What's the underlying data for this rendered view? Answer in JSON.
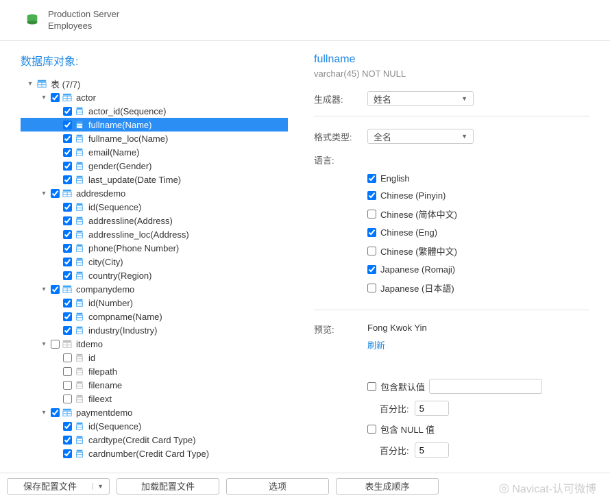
{
  "header": {
    "server": "Production Server",
    "database": "Employees"
  },
  "left": {
    "title": "数据库对象:",
    "root_label": "表 (7/7)",
    "tables": [
      {
        "name": "actor",
        "checked": true,
        "expanded": true,
        "active": true,
        "columns": [
          {
            "label": "actor_id(Sequence)",
            "checked": true
          },
          {
            "label": "fullname(Name)",
            "checked": true,
            "selected": true
          },
          {
            "label": "fullname_loc(Name)",
            "checked": true
          },
          {
            "label": "email(Name)",
            "checked": true
          },
          {
            "label": "gender(Gender)",
            "checked": true
          },
          {
            "label": "last_update(Date Time)",
            "checked": true
          }
        ]
      },
      {
        "name": "addresdemo",
        "checked": true,
        "expanded": true,
        "active": true,
        "columns": [
          {
            "label": "id(Sequence)",
            "checked": true
          },
          {
            "label": "addressline(Address)",
            "checked": true
          },
          {
            "label": "addressline_loc(Address)",
            "checked": true
          },
          {
            "label": "phone(Phone Number)",
            "checked": true
          },
          {
            "label": "city(City)",
            "checked": true
          },
          {
            "label": "country(Region)",
            "checked": true
          }
        ]
      },
      {
        "name": "companydemo",
        "checked": true,
        "expanded": true,
        "active": true,
        "columns": [
          {
            "label": "id(Number)",
            "checked": true
          },
          {
            "label": "compname(Name)",
            "checked": true
          },
          {
            "label": "industry(Industry)",
            "checked": true
          }
        ]
      },
      {
        "name": "itdemo",
        "checked": false,
        "expanded": true,
        "active": false,
        "columns": [
          {
            "label": "id",
            "checked": false
          },
          {
            "label": "filepath",
            "checked": false
          },
          {
            "label": "filename",
            "checked": false
          },
          {
            "label": "fileext",
            "checked": false
          }
        ]
      },
      {
        "name": "paymentdemo",
        "checked": true,
        "expanded": true,
        "active": true,
        "columns": [
          {
            "label": "id(Sequence)",
            "checked": true
          },
          {
            "label": "cardtype(Credit Card Type)",
            "checked": true
          },
          {
            "label": "cardnumber(Credit Card Type)",
            "checked": true
          }
        ]
      }
    ]
  },
  "right": {
    "column_name": "fullname",
    "column_type": "varchar(45) NOT NULL",
    "generator_label": "生成器:",
    "generator_value": "姓名",
    "format_label": "格式类型:",
    "format_value": "全名",
    "language_label": "语言:",
    "languages": [
      {
        "label": "English",
        "checked": true
      },
      {
        "label": "Chinese (Pinyin)",
        "checked": true
      },
      {
        "label": "Chinese (简体中文)",
        "checked": false
      },
      {
        "label": "Chinese (Eng)",
        "checked": true
      },
      {
        "label": "Chinese (繁體中文)",
        "checked": false
      },
      {
        "label": "Japanese (Romaji)",
        "checked": true
      },
      {
        "label": "Japanese (日本語)",
        "checked": false
      }
    ],
    "preview_label": "预览:",
    "preview_value": "Fong Kwok Yin",
    "refresh_label": "刷新",
    "include_default_label": "包含默认值",
    "include_default_checked": false,
    "default_percent_label": "百分比:",
    "default_percent_value": "5",
    "include_null_label": "包含 NULL 值",
    "include_null_checked": false,
    "null_percent_label": "百分比:",
    "null_percent_value": "5"
  },
  "footer": {
    "save_profile": "保存配置文件",
    "load_profile": "加载配置文件",
    "options": "选项",
    "table_order": "表生成顺序"
  },
  "watermark": "Navicat-认可微博"
}
